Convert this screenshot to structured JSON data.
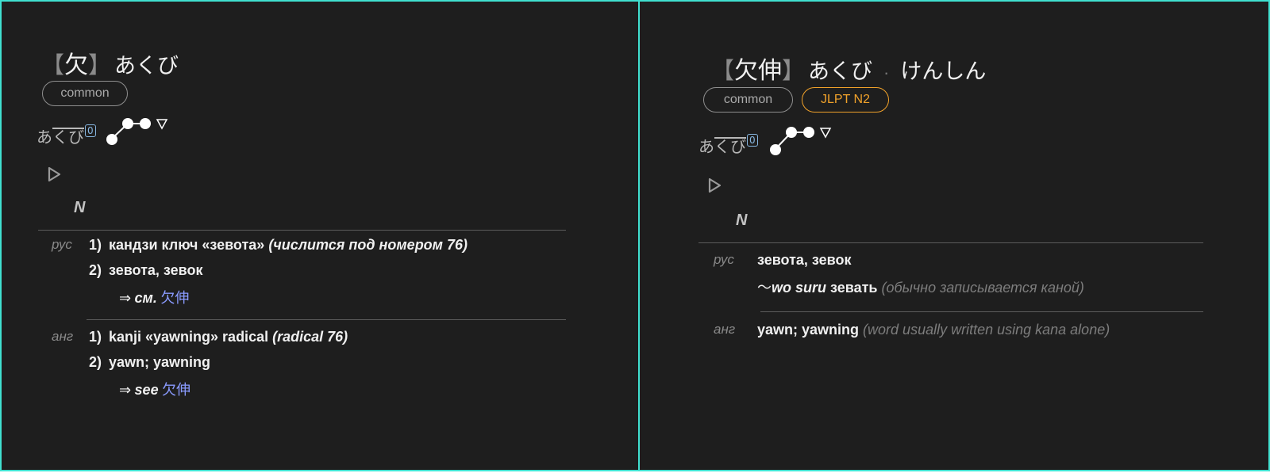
{
  "left": {
    "headword": {
      "bracket_open": "【",
      "kanji": "欠",
      "bracket_close": "】",
      "reading": "あくび"
    },
    "tags": [
      "common"
    ],
    "pitch": {
      "kana_high": "くび",
      "kana_low": "あ",
      "accent": "0",
      "tail": "▽"
    },
    "pos": "N",
    "senses": [
      {
        "lang": "рус",
        "items": [
          {
            "num": "1)",
            "text": "кандзи ключ «зевота»",
            "note": "(числится под номером 76)"
          },
          {
            "num": "2)",
            "text": "зевота, зевок"
          }
        ],
        "xref": {
          "arrow": "⇒",
          "label": "см.",
          "link": "欠伸"
        }
      },
      {
        "lang": "анг",
        "items": [
          {
            "num": "1)",
            "text": "kanji «yawning» radical",
            "note": "(radical 76)"
          },
          {
            "num": "2)",
            "text": "yawn; yawning"
          }
        ],
        "xref": {
          "arrow": "⇒",
          "label": "see",
          "link": "欠伸"
        }
      }
    ]
  },
  "right": {
    "headword": {
      "bracket_open": "【",
      "kanji": "欠伸",
      "bracket_close": "】",
      "reading": "あくび",
      "separator": "·",
      "reading2": "けんしん"
    },
    "tags": [
      "common",
      "JLPT N2"
    ],
    "pitch": {
      "kana_high": "くび",
      "kana_low": "あ",
      "accent": "0",
      "tail": "▽"
    },
    "pos": "N",
    "senses": [
      {
        "lang": "рус",
        "line1": "зевота, зевок",
        "line2_prefix": "〜",
        "line2_em": "wo suru",
        "line2_text": " зевать",
        "line2_note": "(обычно записывается каной)"
      },
      {
        "lang": "анг",
        "line1": "yawn; yawning",
        "line1_note": "(word usually written using kana alone)"
      }
    ]
  },
  "colors": {
    "frame": "#40e0d0",
    "panel_bg": "#1e1e1e",
    "jlpt": "#f0a12a",
    "link": "#8a9bff",
    "accent_box": "#87b6e0"
  }
}
